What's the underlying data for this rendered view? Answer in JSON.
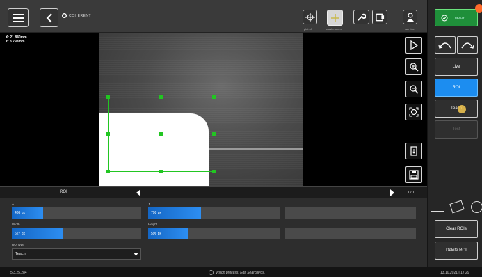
{
  "brand": {
    "name": "COHERENT"
  },
  "toolbar": {
    "plot_label": "plot off",
    "cluster_label": "cluster open",
    "service_label": "service",
    "ready_label": "READY",
    "notification_count": ""
  },
  "viewer": {
    "coord_x": "X: 21.840mm",
    "coord_y": "Y: 3.793mm"
  },
  "right_panel": {
    "live": "Live",
    "roi": "ROI",
    "teach": "Teach",
    "test": "Test",
    "clear_rois": "Clear ROIs",
    "delete_roi": "Delete ROI"
  },
  "param_header": {
    "title": "ROI",
    "page": "1 / 1"
  },
  "params": {
    "x_label": "X",
    "x_value": "486 px",
    "x_fill": 0.24,
    "y_label": "Y",
    "y_value": "798 px",
    "y_fill": 0.4,
    "width_label": "Width",
    "width_value": "627 px",
    "width_fill": 0.4,
    "height_label": "Height",
    "height_value": "596 px",
    "height_fill": 0.3,
    "roitype_label": "ROI type",
    "roitype_value": "Teach"
  },
  "status": {
    "version": "5.3.25.284",
    "message": "Vision process: Edit SearchPos.",
    "datetime": "13.10.2021 | 17:29"
  },
  "colors": {
    "accent": "#1c8df0",
    "roi_box": "#22c622",
    "ready": "#1f8f3a"
  }
}
